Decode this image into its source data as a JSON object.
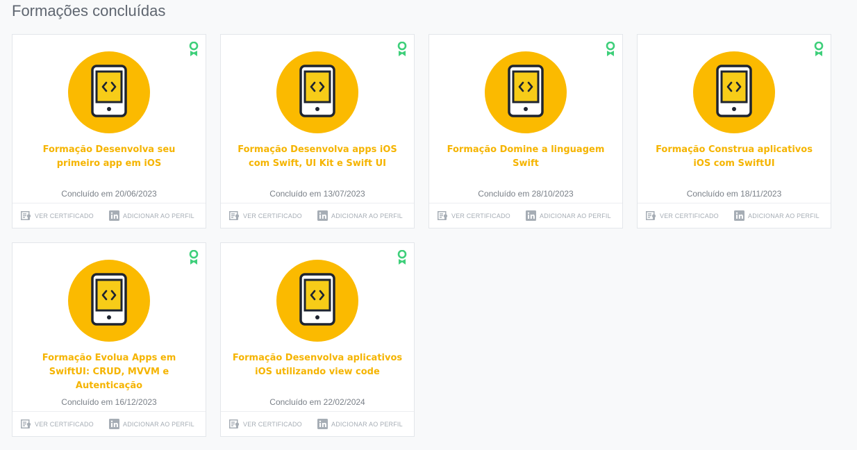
{
  "page": {
    "title": "Formações concluídas"
  },
  "colors": {
    "accent": "#f5b400",
    "badge_bg": "#fbba00",
    "ribbon": "#3ecf7a",
    "muted": "#a6adb5"
  },
  "actions": {
    "view_certificate": "VER CERTIFICADO",
    "add_to_profile": "ADICIONAR AO PERFIL"
  },
  "cards": [
    {
      "title": "Formação Desenvolva seu primeiro app em iOS",
      "date": "Concluído em 20/06/2023",
      "icon": "mobile-code-icon"
    },
    {
      "title": "Formação Desenvolva apps iOS com Swift, UI Kit e Swift UI",
      "date": "Concluído em 13/07/2023",
      "icon": "mobile-code-icon"
    },
    {
      "title": "Formação Domine a linguagem Swift",
      "date": "Concluído em 28/10/2023",
      "icon": "mobile-code-icon"
    },
    {
      "title": "Formação Construa aplicativos iOS com SwiftUI",
      "date": "Concluído em 18/11/2023",
      "icon": "mobile-code-icon"
    },
    {
      "title": "Formação Evolua Apps em SwiftUI: CRUD, MVVM e Autenticação",
      "date": "Concluído em 16/12/2023",
      "icon": "mobile-code-icon"
    },
    {
      "title": "Formação Desenvolva aplicativos iOS utilizando view code",
      "date": "Concluído em 22/02/2024",
      "icon": "mobile-code-icon"
    }
  ]
}
